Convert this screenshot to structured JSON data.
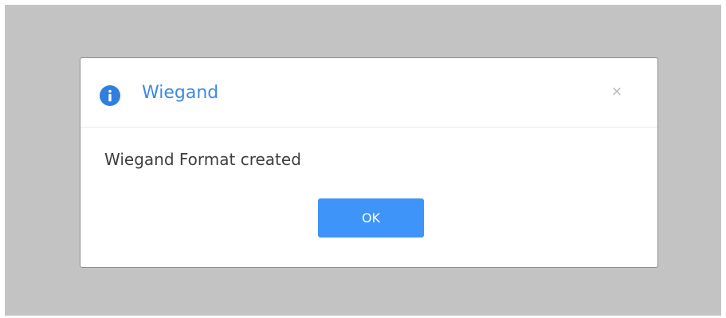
{
  "dialog": {
    "title": "Wiegand",
    "message": "Wiegand Format created",
    "ok_label": "OK",
    "close_glyph": "×",
    "icon": "info-icon"
  },
  "colors": {
    "backdrop": "#c3c3c3",
    "title": "#3b8ae6",
    "icon": "#2f7fdf",
    "button": "#3e94f8"
  }
}
